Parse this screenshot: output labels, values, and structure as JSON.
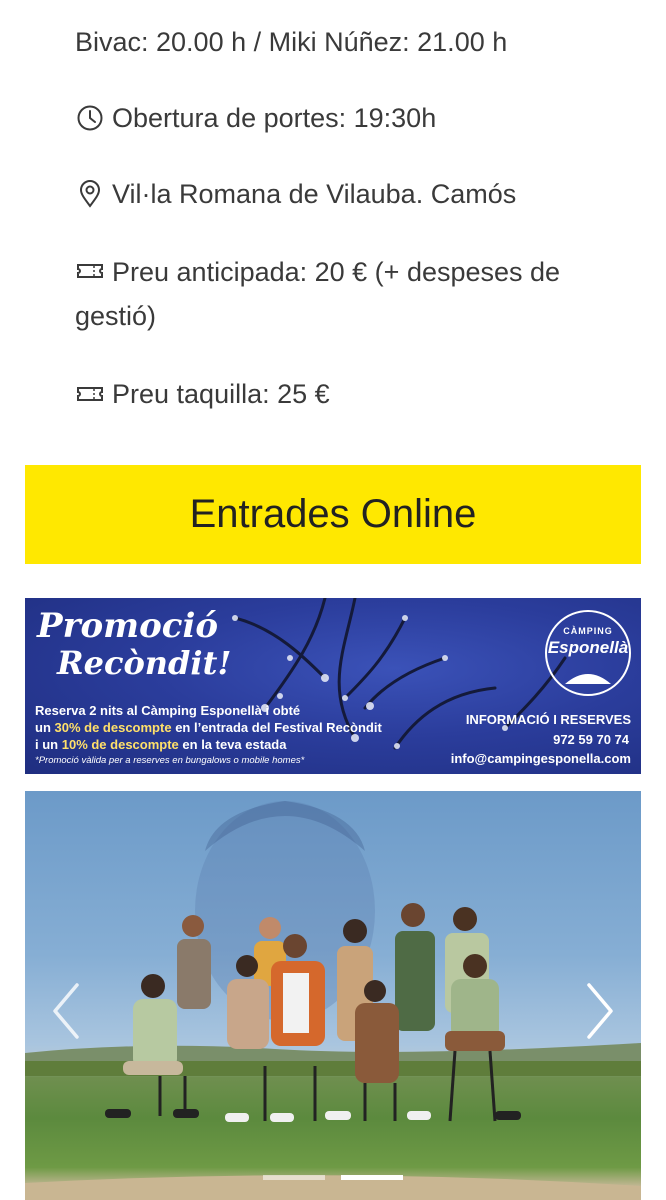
{
  "event_info": {
    "schedule": "Bivac: 20.00 h / Miki Núñez: 21.00 h",
    "doors": "Obertura de portes: 19:30h",
    "venue": "Vil·la Romana de Vilauba. Camós",
    "advance_price": "Preu anticipada: 20 € (+ despeses de gestió)",
    "box_office_price": "Preu taquilla: 25 €",
    "icons": [
      "clock-icon",
      "location-pin-icon",
      "ticket-icon",
      "ticket-icon"
    ]
  },
  "cta": {
    "label": "Entrades Online",
    "background": "#ffe800"
  },
  "promo_banner": {
    "title_line1": "Promoció",
    "title_line2": "Recòndit!",
    "text_line1": "Reserva 2 nits al Càmping Esponellà i obté",
    "text_line2_prefix": "un",
    "text_line2_highlight": "30% de descompte",
    "text_line2_suffix": "en l’entrada del Festival Recòndit",
    "text_line3_prefix": "i un",
    "text_line3_highlight": "10% de descompte",
    "text_line3_suffix": "en la teva estada",
    "note": "*Promoció vàlida per a reserves en bungalows o mobile homes*",
    "logo_small": "CÀMPING",
    "logo_big": "Esponellà",
    "info_title": "INFORMACIÓ I RESERVES",
    "phone": "972 59 70 74",
    "email": "info@campingesponella.com",
    "background": "#2b3d9c"
  },
  "slider": {
    "slide_count": 2,
    "active_index": 1,
    "prev_icon": "chevron-left-icon",
    "next_icon": "chevron-right-icon"
  }
}
